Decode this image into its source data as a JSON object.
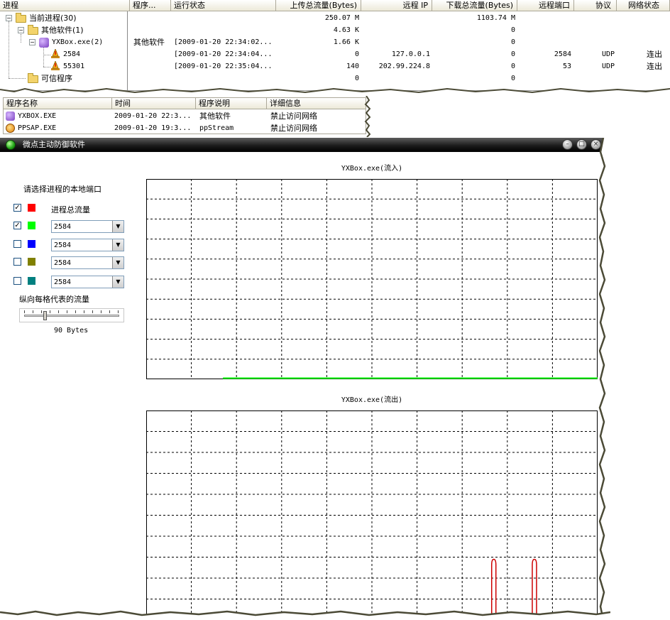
{
  "proc_table": {
    "columns": [
      "进程",
      "程序...",
      "运行状态",
      "上传总流量(Bytes)",
      "远程 IP",
      "下载总流量(Bytes)",
      "远程端口",
      "协议",
      "网络状态"
    ],
    "rows": [
      {
        "name": "当前进程(30)",
        "prog": "",
        "status": "",
        "up": "250.07 M",
        "ip": "",
        "down": "1103.74 M",
        "port": "",
        "proto": "",
        "net": ""
      },
      {
        "name": "其他软件(1)",
        "prog": "",
        "status": "",
        "up": "4.63 K",
        "ip": "",
        "down": "0",
        "port": "",
        "proto": "",
        "net": ""
      },
      {
        "name": "YXBox.exe(2)",
        "prog": "其他软件",
        "status": "[2009-01-20 22:34:02...",
        "up": "1.66 K",
        "ip": "",
        "down": "0",
        "port": "",
        "proto": "",
        "net": ""
      },
      {
        "name": "2584",
        "prog": "",
        "status": "[2009-01-20 22:34:04...",
        "up": "0",
        "ip": "127.0.0.1",
        "down": "0",
        "port": "2584",
        "proto": "UDP",
        "net": "连出"
      },
      {
        "name": "55301",
        "prog": "",
        "status": "[2009-01-20 22:35:04...",
        "up": "140",
        "ip": "202.99.224.8",
        "down": "0",
        "port": "53",
        "proto": "UDP",
        "net": "连出"
      },
      {
        "name": "可信程序",
        "prog": "",
        "status": "",
        "up": "0",
        "ip": "",
        "down": "0",
        "port": "",
        "proto": "",
        "net": ""
      }
    ]
  },
  "alert_table": {
    "columns": [
      "程序名称",
      "时间",
      "程序说明",
      "详细信息"
    ],
    "rows": [
      {
        "name": "YXBOX.EXE",
        "time": "2009-01-20 22:3...",
        "desc": "其他软件",
        "detail": "禁止访问网络"
      },
      {
        "name": "PPSAP.EXE",
        "time": "2009-01-20 19:3...",
        "desc": "ppStream",
        "detail": "禁止访问网络"
      }
    ]
  },
  "window": {
    "title": "微点主动防御软件",
    "controls": {
      "minimize": "–",
      "maximize": "□",
      "close": "×"
    },
    "port_heading": "请选择进程的本地端口",
    "ports": [
      {
        "label": "进程总流量",
        "checked": true,
        "color": "#ff0000",
        "type": "label"
      },
      {
        "value": "2584",
        "checked": true,
        "color": "#00ff00",
        "type": "combo"
      },
      {
        "value": "2584",
        "checked": false,
        "color": "#0000ff",
        "type": "combo"
      },
      {
        "value": "2584",
        "checked": false,
        "color": "#808000",
        "type": "combo"
      },
      {
        "value": "2584",
        "checked": false,
        "color": "#008080",
        "type": "combo"
      }
    ],
    "slider_label": "纵向每格代表的流量",
    "slider_value": "90 Bytes",
    "slider_position": 0.22
  },
  "chart_data": [
    {
      "type": "line",
      "title": "YXBox.exe(流入)",
      "grid": true,
      "grid_cols": 10,
      "grid_rows": 10,
      "series": [
        {
          "color": "#00ff00",
          "values": [
            0,
            0,
            0,
            0,
            0,
            0,
            0,
            0,
            0,
            0
          ],
          "start_fraction": 0.17
        }
      ]
    },
    {
      "type": "line",
      "title": "YXBox.exe(流出)",
      "grid": true,
      "grid_cols": 10,
      "grid_rows": 10,
      "series": [
        {
          "color": "#00ff00",
          "values": [
            0,
            0,
            0,
            0,
            0,
            0,
            0,
            0,
            0,
            0
          ],
          "start_fraction": 0.17
        },
        {
          "color": "#cc0000",
          "spikes_at_fraction": [
            0.77,
            0.86
          ],
          "spike_height_fraction": 0.29
        }
      ]
    }
  ]
}
